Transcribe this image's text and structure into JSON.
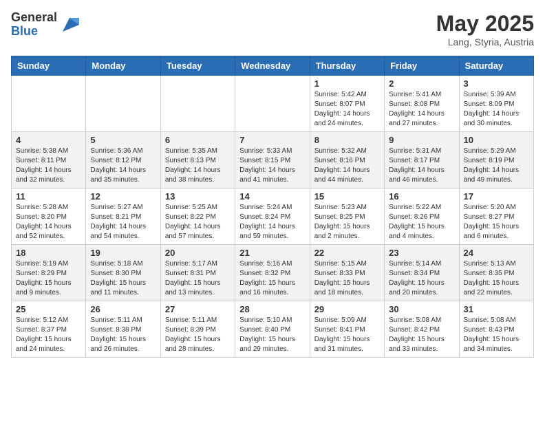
{
  "header": {
    "logo_general": "General",
    "logo_blue": "Blue",
    "month_year": "May 2025",
    "location": "Lang, Styria, Austria"
  },
  "weekdays": [
    "Sunday",
    "Monday",
    "Tuesday",
    "Wednesday",
    "Thursday",
    "Friday",
    "Saturday"
  ],
  "weeks": [
    [
      {
        "day": "",
        "info": ""
      },
      {
        "day": "",
        "info": ""
      },
      {
        "day": "",
        "info": ""
      },
      {
        "day": "",
        "info": ""
      },
      {
        "day": "1",
        "info": "Sunrise: 5:42 AM\nSunset: 8:07 PM\nDaylight: 14 hours\nand 24 minutes."
      },
      {
        "day": "2",
        "info": "Sunrise: 5:41 AM\nSunset: 8:08 PM\nDaylight: 14 hours\nand 27 minutes."
      },
      {
        "day": "3",
        "info": "Sunrise: 5:39 AM\nSunset: 8:09 PM\nDaylight: 14 hours\nand 30 minutes."
      }
    ],
    [
      {
        "day": "4",
        "info": "Sunrise: 5:38 AM\nSunset: 8:11 PM\nDaylight: 14 hours\nand 32 minutes."
      },
      {
        "day": "5",
        "info": "Sunrise: 5:36 AM\nSunset: 8:12 PM\nDaylight: 14 hours\nand 35 minutes."
      },
      {
        "day": "6",
        "info": "Sunrise: 5:35 AM\nSunset: 8:13 PM\nDaylight: 14 hours\nand 38 minutes."
      },
      {
        "day": "7",
        "info": "Sunrise: 5:33 AM\nSunset: 8:15 PM\nDaylight: 14 hours\nand 41 minutes."
      },
      {
        "day": "8",
        "info": "Sunrise: 5:32 AM\nSunset: 8:16 PM\nDaylight: 14 hours\nand 44 minutes."
      },
      {
        "day": "9",
        "info": "Sunrise: 5:31 AM\nSunset: 8:17 PM\nDaylight: 14 hours\nand 46 minutes."
      },
      {
        "day": "10",
        "info": "Sunrise: 5:29 AM\nSunset: 8:19 PM\nDaylight: 14 hours\nand 49 minutes."
      }
    ],
    [
      {
        "day": "11",
        "info": "Sunrise: 5:28 AM\nSunset: 8:20 PM\nDaylight: 14 hours\nand 52 minutes."
      },
      {
        "day": "12",
        "info": "Sunrise: 5:27 AM\nSunset: 8:21 PM\nDaylight: 14 hours\nand 54 minutes."
      },
      {
        "day": "13",
        "info": "Sunrise: 5:25 AM\nSunset: 8:22 PM\nDaylight: 14 hours\nand 57 minutes."
      },
      {
        "day": "14",
        "info": "Sunrise: 5:24 AM\nSunset: 8:24 PM\nDaylight: 14 hours\nand 59 minutes."
      },
      {
        "day": "15",
        "info": "Sunrise: 5:23 AM\nSunset: 8:25 PM\nDaylight: 15 hours\nand 2 minutes."
      },
      {
        "day": "16",
        "info": "Sunrise: 5:22 AM\nSunset: 8:26 PM\nDaylight: 15 hours\nand 4 minutes."
      },
      {
        "day": "17",
        "info": "Sunrise: 5:20 AM\nSunset: 8:27 PM\nDaylight: 15 hours\nand 6 minutes."
      }
    ],
    [
      {
        "day": "18",
        "info": "Sunrise: 5:19 AM\nSunset: 8:29 PM\nDaylight: 15 hours\nand 9 minutes."
      },
      {
        "day": "19",
        "info": "Sunrise: 5:18 AM\nSunset: 8:30 PM\nDaylight: 15 hours\nand 11 minutes."
      },
      {
        "day": "20",
        "info": "Sunrise: 5:17 AM\nSunset: 8:31 PM\nDaylight: 15 hours\nand 13 minutes."
      },
      {
        "day": "21",
        "info": "Sunrise: 5:16 AM\nSunset: 8:32 PM\nDaylight: 15 hours\nand 16 minutes."
      },
      {
        "day": "22",
        "info": "Sunrise: 5:15 AM\nSunset: 8:33 PM\nDaylight: 15 hours\nand 18 minutes."
      },
      {
        "day": "23",
        "info": "Sunrise: 5:14 AM\nSunset: 8:34 PM\nDaylight: 15 hours\nand 20 minutes."
      },
      {
        "day": "24",
        "info": "Sunrise: 5:13 AM\nSunset: 8:35 PM\nDaylight: 15 hours\nand 22 minutes."
      }
    ],
    [
      {
        "day": "25",
        "info": "Sunrise: 5:12 AM\nSunset: 8:37 PM\nDaylight: 15 hours\nand 24 minutes."
      },
      {
        "day": "26",
        "info": "Sunrise: 5:11 AM\nSunset: 8:38 PM\nDaylight: 15 hours\nand 26 minutes."
      },
      {
        "day": "27",
        "info": "Sunrise: 5:11 AM\nSunset: 8:39 PM\nDaylight: 15 hours\nand 28 minutes."
      },
      {
        "day": "28",
        "info": "Sunrise: 5:10 AM\nSunset: 8:40 PM\nDaylight: 15 hours\nand 29 minutes."
      },
      {
        "day": "29",
        "info": "Sunrise: 5:09 AM\nSunset: 8:41 PM\nDaylight: 15 hours\nand 31 minutes."
      },
      {
        "day": "30",
        "info": "Sunrise: 5:08 AM\nSunset: 8:42 PM\nDaylight: 15 hours\nand 33 minutes."
      },
      {
        "day": "31",
        "info": "Sunrise: 5:08 AM\nSunset: 8:43 PM\nDaylight: 15 hours\nand 34 minutes."
      }
    ]
  ]
}
